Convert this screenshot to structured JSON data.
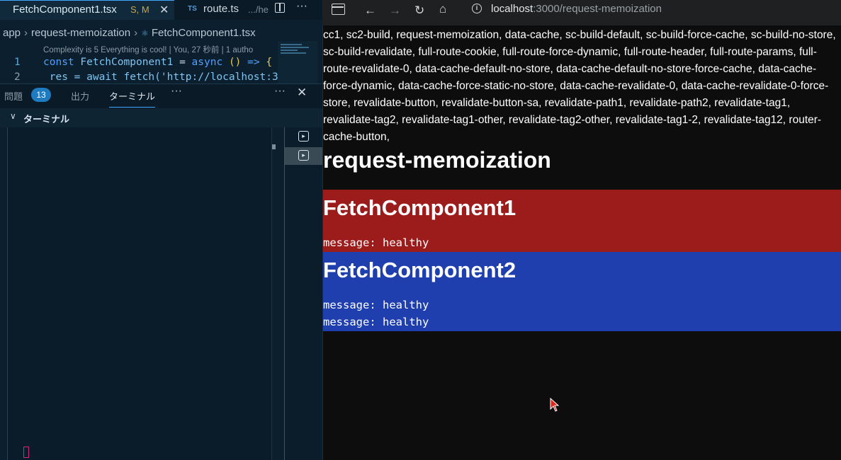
{
  "editor": {
    "tabs": [
      {
        "label": "FetchComponent1.tsx",
        "status": "S, M",
        "close": "✕"
      },
      {
        "type_badge": "TS",
        "label": "route.ts",
        "path": ".../he"
      }
    ],
    "more": "···",
    "breadcrumb": [
      "app",
      "request-memoization",
      "FetchComponent1.tsx"
    ],
    "codelens": "Complexity is 5 Everything is cool! | You, 27 秒前 | 1 autho",
    "lines": [
      {
        "num": "1",
        "kw": "const",
        "name": "FetchComponent1",
        "rest": " = ",
        "async": "async",
        "paren": "()",
        "arrow": " => ",
        "brace": "{"
      },
      {
        "num": "2",
        "text": " res = await fetch('http://localhost:3"
      }
    ],
    "panel": {
      "problems_label": "問題",
      "problems_count": "13",
      "output_label": "出力",
      "terminal_label": "ターミナル",
      "more": "···",
      "close": "✕",
      "section_title": "ターミナル"
    }
  },
  "browser": {
    "url_host": "localhost",
    "url_rest": ":3000/request-memoization",
    "routes_text": "cc1, sc2-build, request-memoization, data-cache, sc-build-default, sc-build-force-cache, sc-build-no-store, sc-build-revalidate, full-route-cookie, full-route-force-dynamic, full-route-header, full-route-params, full-route-revalidate-0, data-cache-default-no-store, data-cache-default-no-store-force-cache, data-cache-force-dynamic, data-cache-force-static-no-store, data-cache-revalidate-0, data-cache-revalidate-0-force-store, revalidate-button, revalidate-button-sa, revalidate-path1, revalidate-path2, revalidate-tag1, revalidate-tag2, revalidate-tag1-other, revalidate-tag2-other, revalidate-tag1-2, revalidate-tag12, router-cache-button,",
    "heading": "request-memoization",
    "component1": {
      "title": "FetchComponent1",
      "messages": [
        "message: healthy"
      ],
      "color": "#9c1c1c"
    },
    "component2": {
      "title": "FetchComponent2",
      "messages": [
        "message: healthy",
        "message: healthy"
      ],
      "color": "#1f3fae"
    }
  }
}
